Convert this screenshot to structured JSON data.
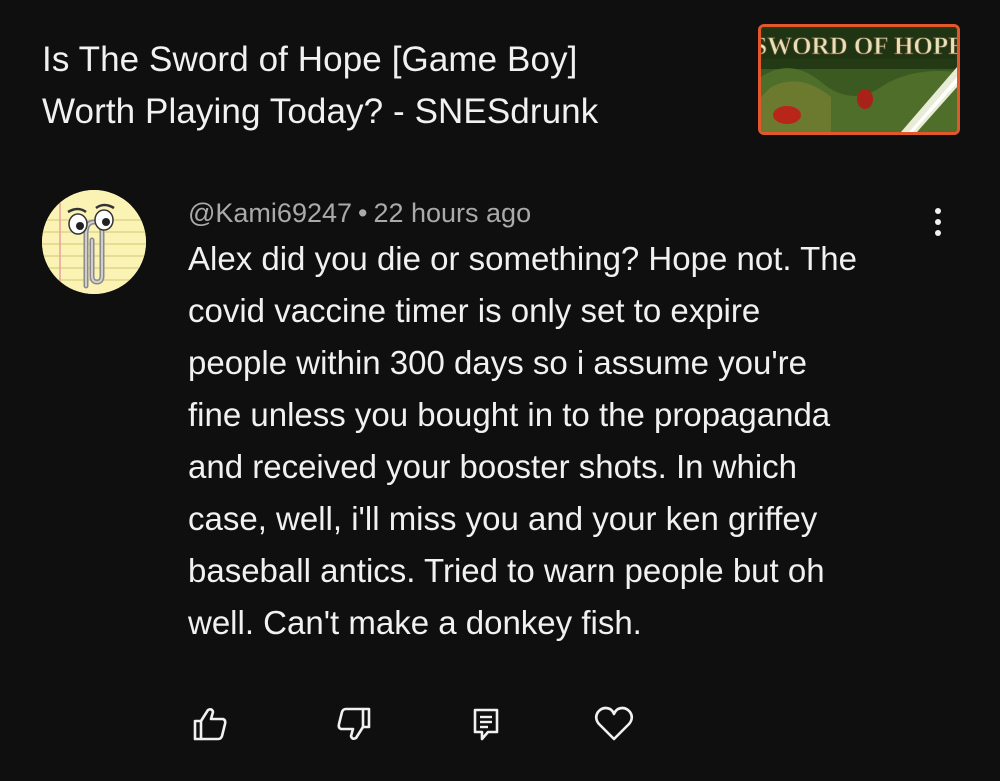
{
  "video": {
    "title_line1": "Is The Sword of Hope [Game Boy]",
    "title_line2": "Worth Playing Today? - SNESdrunk",
    "thumbnail_text": "SWORD OF HOPE"
  },
  "comment": {
    "author": "@Kami69247",
    "separator": "•",
    "time": "22 hours ago",
    "avatar_icon": "clippy-avatar-icon",
    "lines": [
      "Alex did you die or something? Hope not. The",
      "covid vaccine timer is only set to expire",
      "people within 300 days so i assume you're",
      "fine unless you bought in to the propaganda",
      "and received your booster shots. In which",
      "case, well, i'll miss you and your ken griffey",
      "baseball antics. Tried to warn people but oh",
      "well. Can't make a donkey fish."
    ]
  },
  "actions": {
    "icons": [
      "thumbs-up-icon",
      "thumbs-down-icon",
      "reply-icon",
      "heart-icon"
    ]
  },
  "colors": {
    "background": "#0f0f0f",
    "text": "#f1f1f1",
    "meta": "#aaaaaa",
    "thumbnail_border": "#e2582a"
  }
}
